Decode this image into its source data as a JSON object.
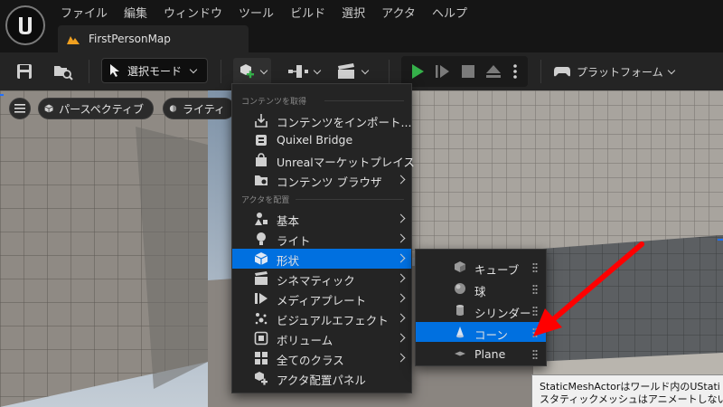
{
  "menubar": [
    "ファイル",
    "編集",
    "ウィンドウ",
    "ツール",
    "ビルド",
    "選択",
    "アクタ",
    "ヘルプ"
  ],
  "tab": {
    "label": "FirstPersonMap"
  },
  "toolbar": {
    "select_mode": "選択モード",
    "platform": "プラットフォーム"
  },
  "viewport": {
    "perspective": "パースペクティブ",
    "lighting": "ライティ"
  },
  "dropdown": {
    "section1": "コンテンツを取得",
    "section2": "アクタを配置",
    "items": [
      {
        "label": "コンテンツをインポート...",
        "icon": "import-icon",
        "submenu": false
      },
      {
        "label": "Quixel Bridge",
        "icon": "bridge-icon",
        "submenu": false
      },
      {
        "label": "Unrealマーケットプレイス",
        "icon": "marketplace-icon",
        "submenu": false
      },
      {
        "label": "コンテンツ ブラウザ",
        "icon": "content-browser-icon",
        "submenu": true
      },
      {
        "label": "基本",
        "icon": "basic-icon",
        "submenu": true
      },
      {
        "label": "ライト",
        "icon": "light-icon",
        "submenu": true
      },
      {
        "label": "形状",
        "icon": "shapes-icon",
        "submenu": true
      },
      {
        "label": "シネマティック",
        "icon": "cinematic-icon",
        "submenu": true
      },
      {
        "label": "メディアプレート",
        "icon": "media-plate-icon",
        "submenu": true
      },
      {
        "label": "ビジュアルエフェクト",
        "icon": "vfx-icon",
        "submenu": true
      },
      {
        "label": "ボリューム",
        "icon": "volume-icon",
        "submenu": true
      },
      {
        "label": "全てのクラス",
        "icon": "all-classes-icon",
        "submenu": true
      },
      {
        "label": "アクタ配置パネル",
        "icon": "place-actors-icon",
        "submenu": false
      }
    ]
  },
  "submenu": {
    "items": [
      {
        "label": "キューブ",
        "icon": "cube-icon"
      },
      {
        "label": "球",
        "icon": "sphere-icon"
      },
      {
        "label": "シリンダー",
        "icon": "cylinder-icon"
      },
      {
        "label": "コーン",
        "icon": "cone-icon"
      },
      {
        "label": "Plane",
        "icon": "plane-icon"
      }
    ]
  },
  "tooltip": {
    "line1": "StaticMeshActorはワールド内のUStati",
    "line2": "スタティックメッシュはアニメートしない"
  },
  "colors": {
    "accent": "#0070e0",
    "play": "#35b04a",
    "annotation_arrow": "#ff0000"
  }
}
